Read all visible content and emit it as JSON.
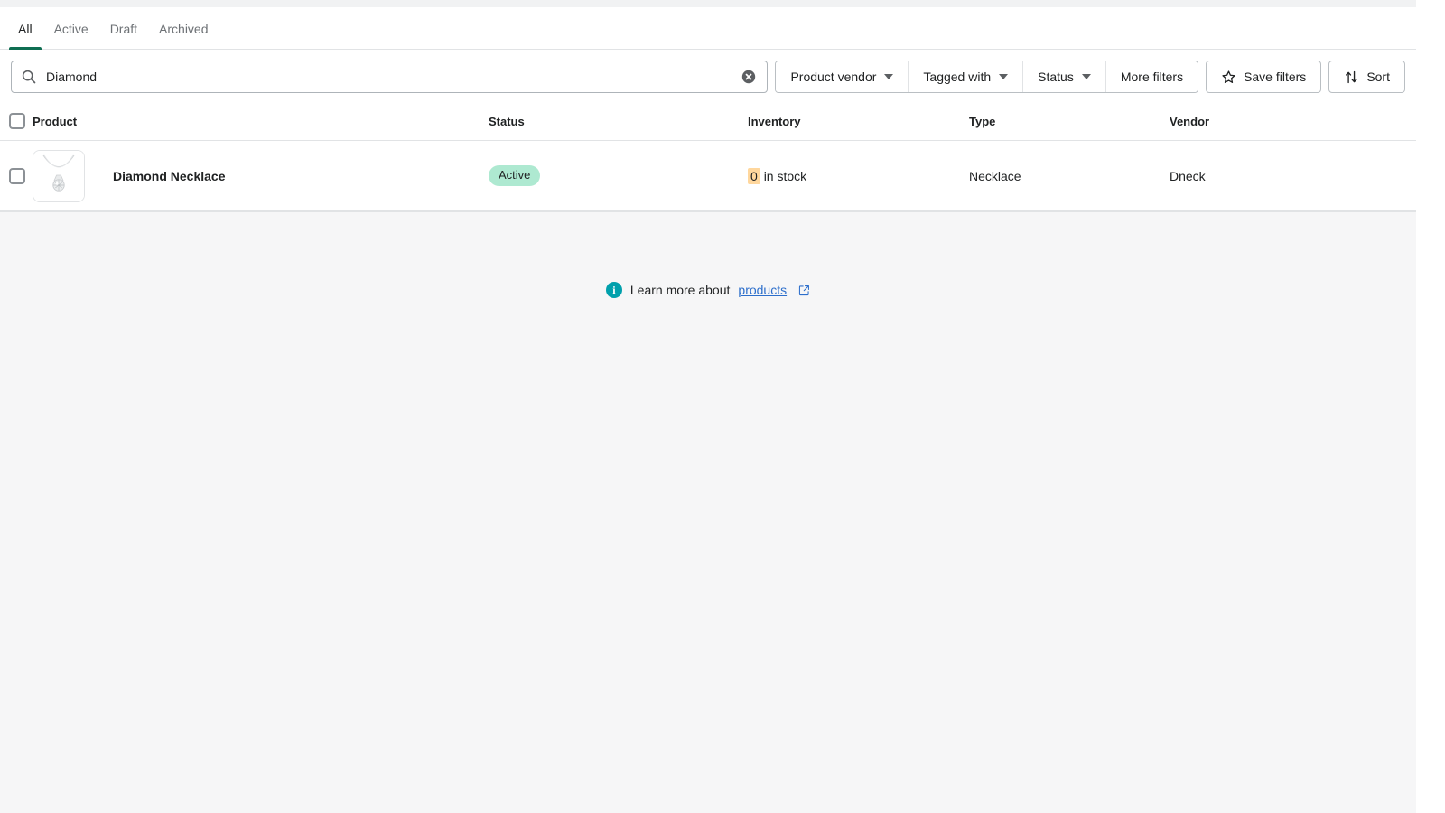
{
  "tabs": [
    {
      "label": "All",
      "active": true
    },
    {
      "label": "Active",
      "active": false
    },
    {
      "label": "Draft",
      "active": false
    },
    {
      "label": "Archived",
      "active": false
    }
  ],
  "search": {
    "value": "Diamond",
    "placeholder": "Search products",
    "icon": "search-icon",
    "clear_icon": "clear-circle-icon"
  },
  "filters": {
    "group": [
      {
        "label": "Product vendor",
        "icon": "chevron-down-icon"
      },
      {
        "label": "Tagged with",
        "icon": "chevron-down-icon"
      },
      {
        "label": "Status",
        "icon": "chevron-down-icon"
      },
      {
        "label": "More filters",
        "icon": ""
      }
    ],
    "save": {
      "label": "Save filters",
      "icon": "star-icon"
    },
    "sort": {
      "label": "Sort",
      "icon": "sort-arrows-icon"
    }
  },
  "table": {
    "columns": [
      "Product",
      "Status",
      "Inventory",
      "Type",
      "Vendor"
    ],
    "rows": [
      {
        "product": "Diamond Necklace",
        "thumbnail": "necklace-pendant-image",
        "status": "Active",
        "inventory_count": "0",
        "inventory_suffix": "in stock",
        "type": "Necklace",
        "vendor": "Dneck"
      }
    ]
  },
  "footer": {
    "icon": "info-icon",
    "text": "Learn more about",
    "link": "products",
    "link_icon": "external-link-icon"
  },
  "colors": {
    "tab_active_underline": "#0f6e52",
    "badge_active_bg": "#aee9d1",
    "inventory_highlight_bg": "#ffd79d",
    "link": "#2c6ecb",
    "info_icon_bg": "#00a0ac",
    "page_bg": "#f6f6f7"
  }
}
